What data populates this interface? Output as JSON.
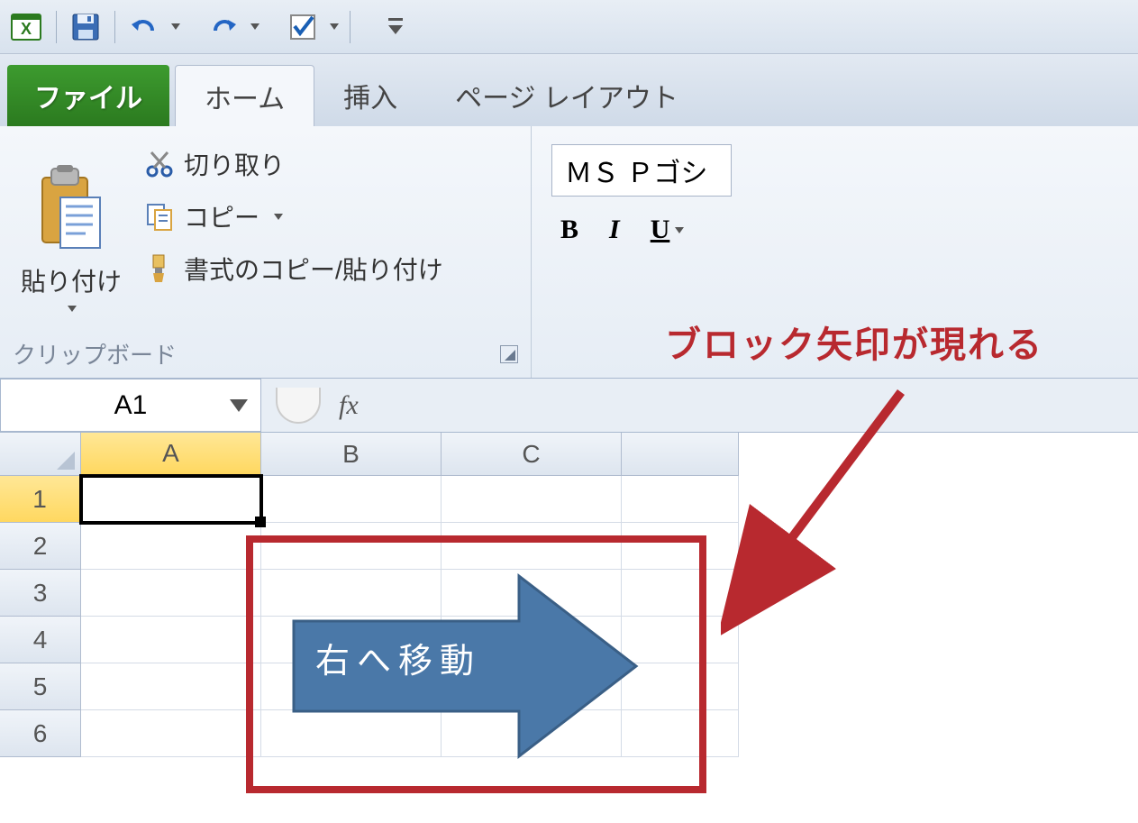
{
  "qat": {
    "app": "Excel"
  },
  "tabs": {
    "file": "ファイル",
    "home": "ホーム",
    "insert": "挿入",
    "layout": "ページ レイアウト"
  },
  "ribbon": {
    "paste": "貼り付け",
    "cut": "切り取り",
    "copy": "コピー",
    "format_painter": "書式のコピー/貼り付け",
    "clipboard_group": "クリップボード",
    "font_name": "ＭＳ Ｐゴシ",
    "bold": "B",
    "italic": "I",
    "underline": "U"
  },
  "formula": {
    "namebox": "A1",
    "fx": "fx"
  },
  "grid": {
    "cols": [
      "A",
      "B",
      "C"
    ],
    "rows": [
      "1",
      "2",
      "3",
      "4",
      "5",
      "6"
    ]
  },
  "annotation": {
    "caption": "ブロック矢印が現れる",
    "arrow_label": "右へ移動"
  }
}
